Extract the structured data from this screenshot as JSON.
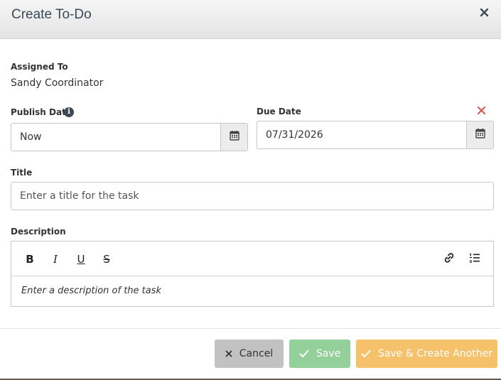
{
  "modal": {
    "title": "Create To-Do"
  },
  "assigned_to": {
    "label": "Assigned To",
    "value": "Sandy Coordinator"
  },
  "publish_date": {
    "label": "Publish Date",
    "value": "Now",
    "info_icon": "i"
  },
  "due_date": {
    "label": "Due Date",
    "value": "07/31/2026"
  },
  "title_field": {
    "label": "Title",
    "placeholder": "Enter a title for the task"
  },
  "description": {
    "label": "Description",
    "placeholder": "Enter a description of the task",
    "toolbar": {
      "bold": "B",
      "italic": "I",
      "underline": "U",
      "strike": "S"
    }
  },
  "footer": {
    "cancel_label": "Cancel",
    "save_label": "Save",
    "save_another_label": "Save & Create Another"
  },
  "colors": {
    "header_text": "#3c4a58",
    "clear_red": "#d9534f",
    "save_green": "#94d09a",
    "save_another_orange": "#f5c16a",
    "cancel_gray": "#c2c2c2"
  }
}
